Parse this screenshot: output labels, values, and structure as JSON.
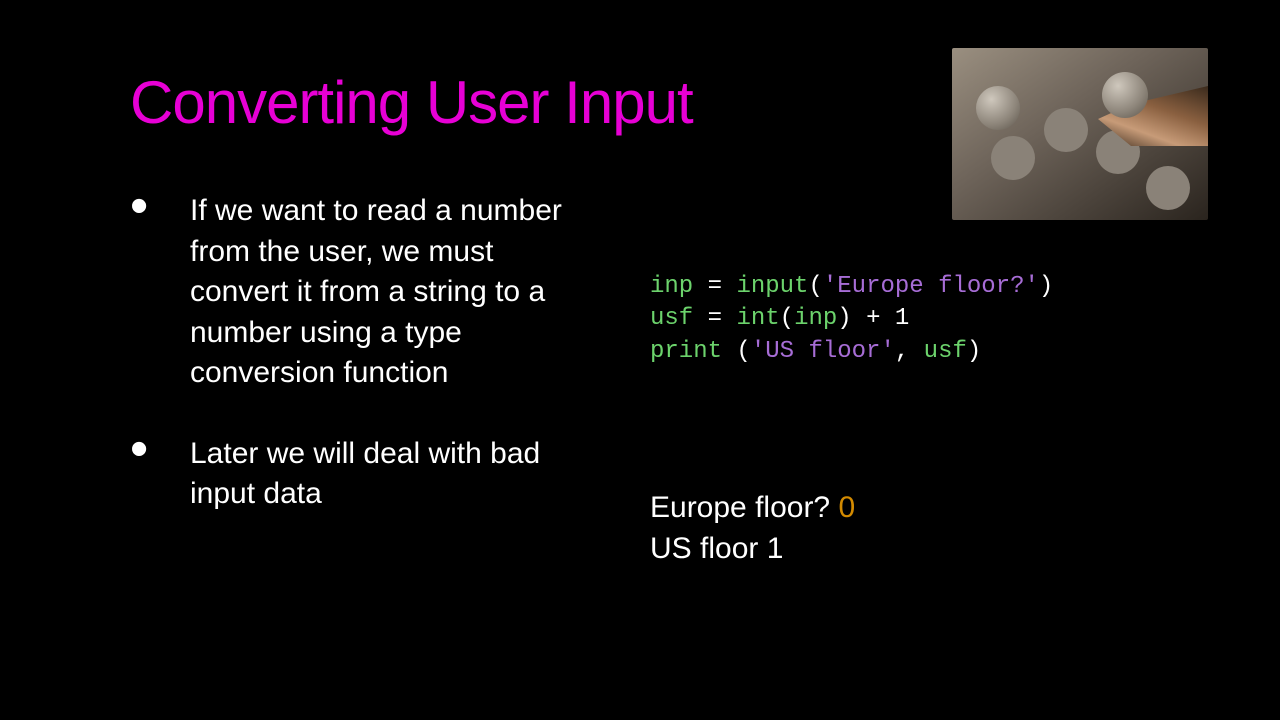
{
  "slide": {
    "title": "Converting User Input",
    "bullets": [
      "If we want to read a number from the user, we must convert it from a string to a number using a type conversion function",
      "Later we will deal with bad input data"
    ],
    "image_alt": "elevator-buttons-photo",
    "code": {
      "l1": {
        "var": "inp",
        "eq": " = ",
        "fn": "input",
        "open": "(",
        "str": "'Europe floor?'",
        "close": ")"
      },
      "l2": {
        "var": "usf",
        "eq": " = ",
        "fn": "int",
        "open": "(",
        "arg": "inp",
        "close": ")",
        "tail": " + 1"
      },
      "l3": {
        "fn": "print",
        "sp": " ",
        "open": "(",
        "str": "'US floor'",
        "comma": ", ",
        "arg": "usf",
        "close": ")"
      }
    },
    "output": {
      "prompt": "Europe floor? ",
      "user_input": "0",
      "result_label": "US floor ",
      "result_value": "1"
    }
  }
}
